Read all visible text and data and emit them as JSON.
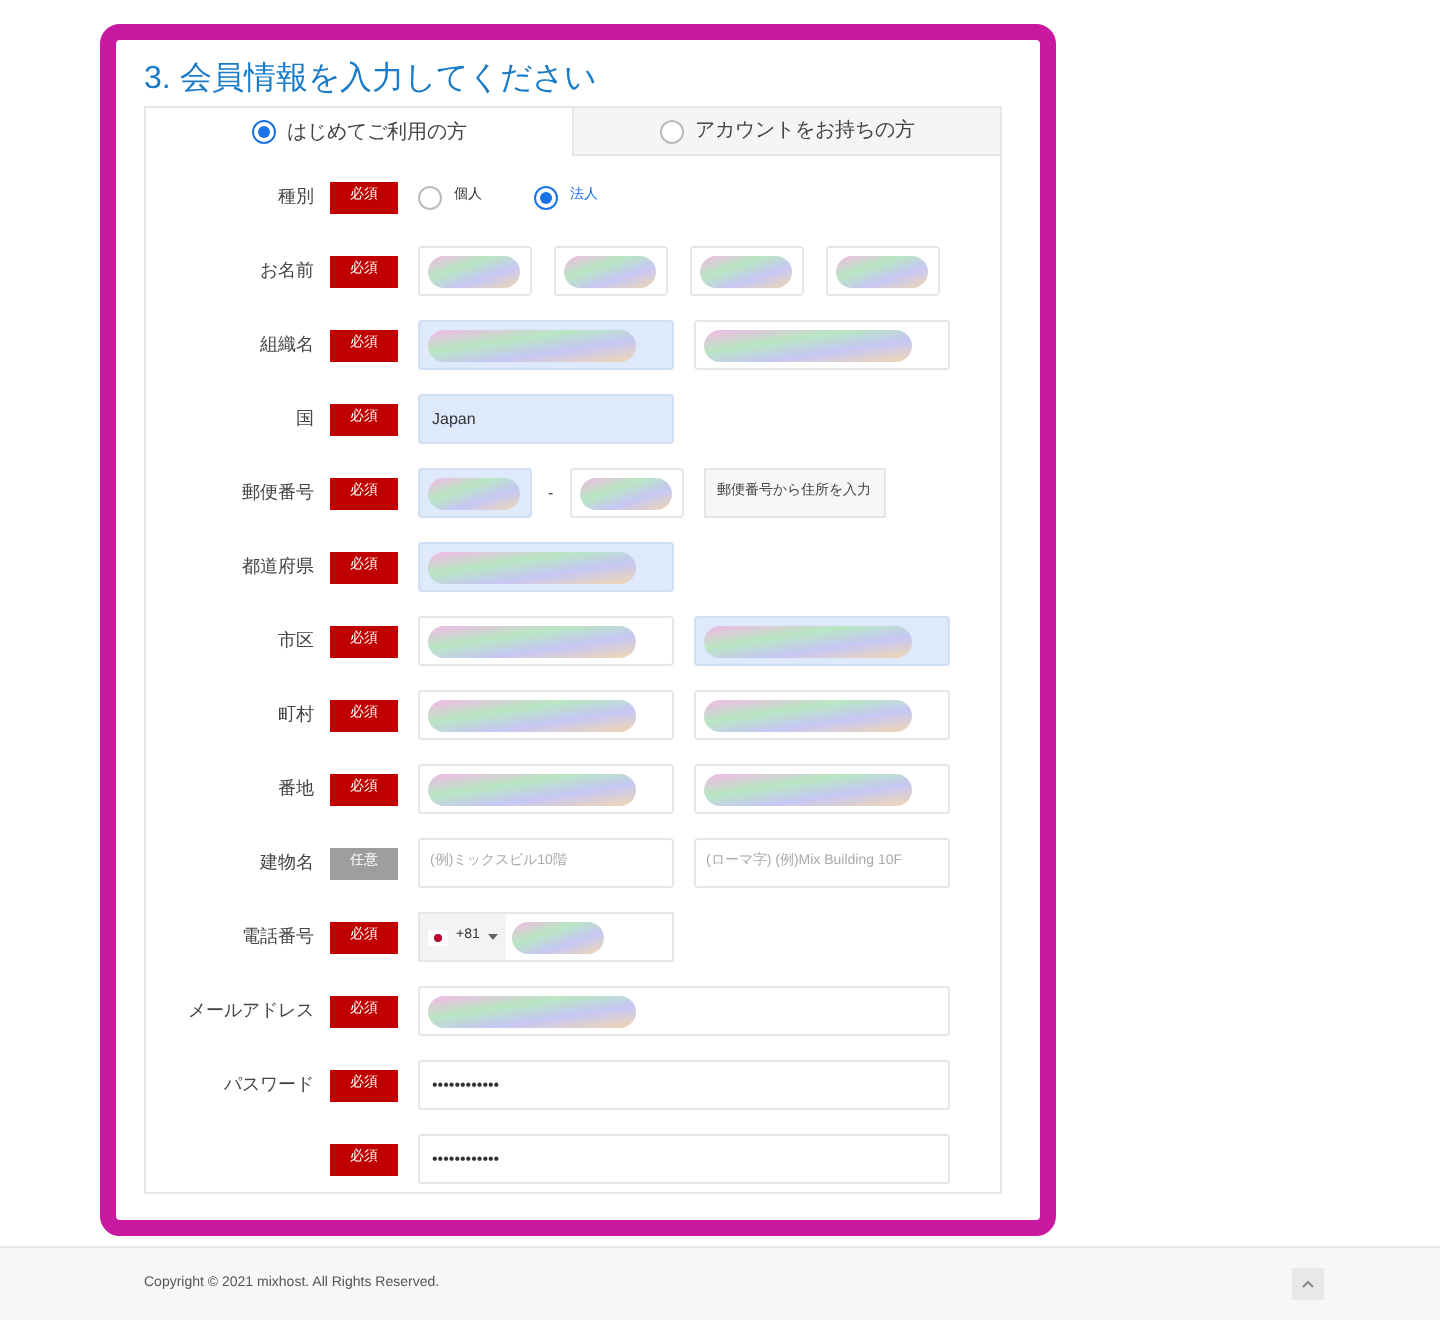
{
  "title": "3. 会員情報を入力してください",
  "tabs": [
    {
      "label": "はじめてご利用の方",
      "selected": true
    },
    {
      "label": "アカウントをお持ちの方",
      "selected": false
    }
  ],
  "rows": [
    {
      "kind": "radio",
      "label": "種別",
      "badge": {
        "text": "必須",
        "required": true
      },
      "options": [
        {
          "label": "個人",
          "selected": false
        },
        {
          "label": "法人",
          "selected": true
        }
      ]
    },
    {
      "kind": "name",
      "label": "お名前",
      "badge": {
        "text": "必須",
        "required": true
      },
      "fields": [
        {
          "kind": "redacted",
          "autofilled": false
        },
        {
          "kind": "redacted",
          "autofilled": false
        },
        {
          "kind": "redacted",
          "autofilled": false
        },
        {
          "kind": "redacted",
          "autofilled": false
        }
      ]
    },
    {
      "kind": "pair",
      "label": "組織名",
      "badge": {
        "text": "必須",
        "required": true
      },
      "fields": [
        {
          "kind": "redacted",
          "autofilled": true
        },
        {
          "kind": "redacted",
          "autofilled": false
        }
      ]
    },
    {
      "kind": "pair",
      "label": "国",
      "badge": {
        "text": "必須",
        "required": true
      },
      "fields": [
        {
          "kind": "value",
          "autofilled": true,
          "value": "Japan"
        }
      ]
    },
    {
      "kind": "postal",
      "label": "郵便番号",
      "badge": {
        "text": "必須",
        "required": true
      },
      "separator": "-",
      "button": "郵便番号から住所を入力",
      "fields": [
        {
          "kind": "redacted",
          "autofilled": true
        },
        {
          "kind": "redacted",
          "autofilled": false
        }
      ]
    },
    {
      "kind": "pair",
      "label": "都道府県",
      "badge": {
        "text": "必須",
        "required": true
      },
      "fields": [
        {
          "kind": "redacted",
          "autofilled": true
        }
      ]
    },
    {
      "kind": "pair",
      "label": "市区",
      "badge": {
        "text": "必須",
        "required": true
      },
      "fields": [
        {
          "kind": "redacted",
          "autofilled": false
        },
        {
          "kind": "redacted",
          "autofilled": true
        }
      ]
    },
    {
      "kind": "pair",
      "label": "町村",
      "badge": {
        "text": "必須",
        "required": true
      },
      "fields": [
        {
          "kind": "redacted",
          "autofilled": false
        },
        {
          "kind": "redacted",
          "autofilled": false
        }
      ]
    },
    {
      "kind": "pair",
      "label": "番地",
      "badge": {
        "text": "必須",
        "required": true
      },
      "fields": [
        {
          "kind": "redacted",
          "autofilled": false
        },
        {
          "kind": "redacted",
          "autofilled": false
        }
      ]
    },
    {
      "kind": "pair",
      "label": "建物名",
      "badge": {
        "text": "任意",
        "required": false
      },
      "fields": [
        {
          "kind": "placeholder",
          "autofilled": false,
          "placeholder": "(例)ミックスビル10階"
        },
        {
          "kind": "placeholder",
          "autofilled": false,
          "placeholder": "(ローマ字) (例)Mix Building 10F"
        }
      ]
    },
    {
      "kind": "phone",
      "label": "電話番号",
      "badge": {
        "text": "必須",
        "required": true
      },
      "code": "+81"
    },
    {
      "kind": "wide",
      "label": "メールアドレス",
      "badge": {
        "text": "必須",
        "required": true
      },
      "fields": [
        {
          "kind": "redacted",
          "autofilled": false
        }
      ]
    },
    {
      "kind": "wide",
      "label": "パスワード",
      "badge": {
        "text": "必須",
        "required": true
      },
      "fields": [
        {
          "kind": "value",
          "autofilled": false,
          "value": "••••••••••••"
        }
      ]
    },
    {
      "kind": "wide",
      "badge": {
        "text": "必須",
        "required": true
      },
      "fields": [
        {
          "kind": "value",
          "autofilled": false,
          "value": "••••••••••••"
        }
      ]
    }
  ],
  "footer": {
    "copyright": "Copyright © 2021 mixhost. All Rights Reserved."
  }
}
